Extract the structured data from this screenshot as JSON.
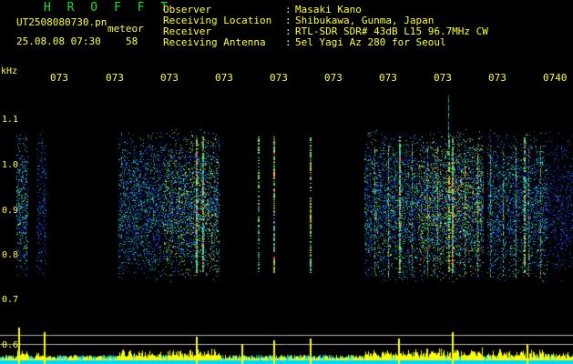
{
  "header": {
    "brand": "H R O F F T",
    "file_name": "UT2508080730.pn",
    "tag": "meteor",
    "timestamp": "25.08.08 07:30",
    "count": "58",
    "info": [
      {
        "label": "Observer",
        "sep": ":",
        "value": "Masaki Kano"
      },
      {
        "label": "Receiving Location",
        "sep": ":",
        "value": "Shibukawa, Gunma, Japan"
      },
      {
        "label": "Receiver",
        "sep": ":",
        "value": "RTL-SDR SDR# 43dB L15 96.7MHz CW"
      },
      {
        "label": "Receiving Antenna",
        "sep": ":",
        "value": "5el Yagi Az 280 for Seoul"
      }
    ]
  },
  "spectrogram": {
    "unit": "kHz",
    "x_ticks": [
      "073",
      "073",
      "073",
      "073",
      "073",
      "073",
      "073",
      "073",
      "073",
      "0740"
    ],
    "y_ticks": [
      "1.1",
      "1.0",
      "0.9",
      "0.8",
      "0.7",
      "0.6"
    ],
    "colors": {
      "background": "#000000",
      "text": "#ffff33",
      "brand": "#22dd22",
      "amplitude": "#ffff00",
      "base": "#00d8ff"
    }
  }
}
